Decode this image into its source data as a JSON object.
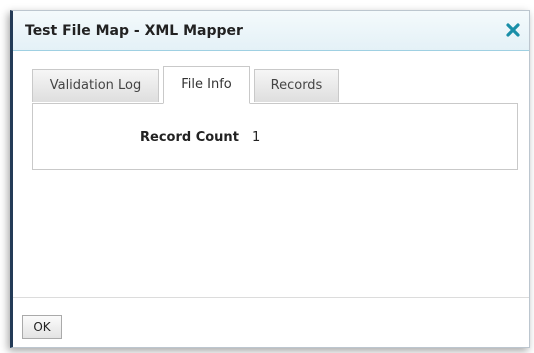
{
  "dialog": {
    "title": "Test File Map - XML Mapper",
    "close_icon": "close-icon",
    "accent_color": "#1a8fa8"
  },
  "tabs": [
    {
      "label": "Validation Log",
      "active": false
    },
    {
      "label": "File Info",
      "active": true
    },
    {
      "label": "Records",
      "active": false
    }
  ],
  "file_info": {
    "record_count_label": "Record Count",
    "record_count_value": "1"
  },
  "footer": {
    "ok_label": "OK"
  }
}
